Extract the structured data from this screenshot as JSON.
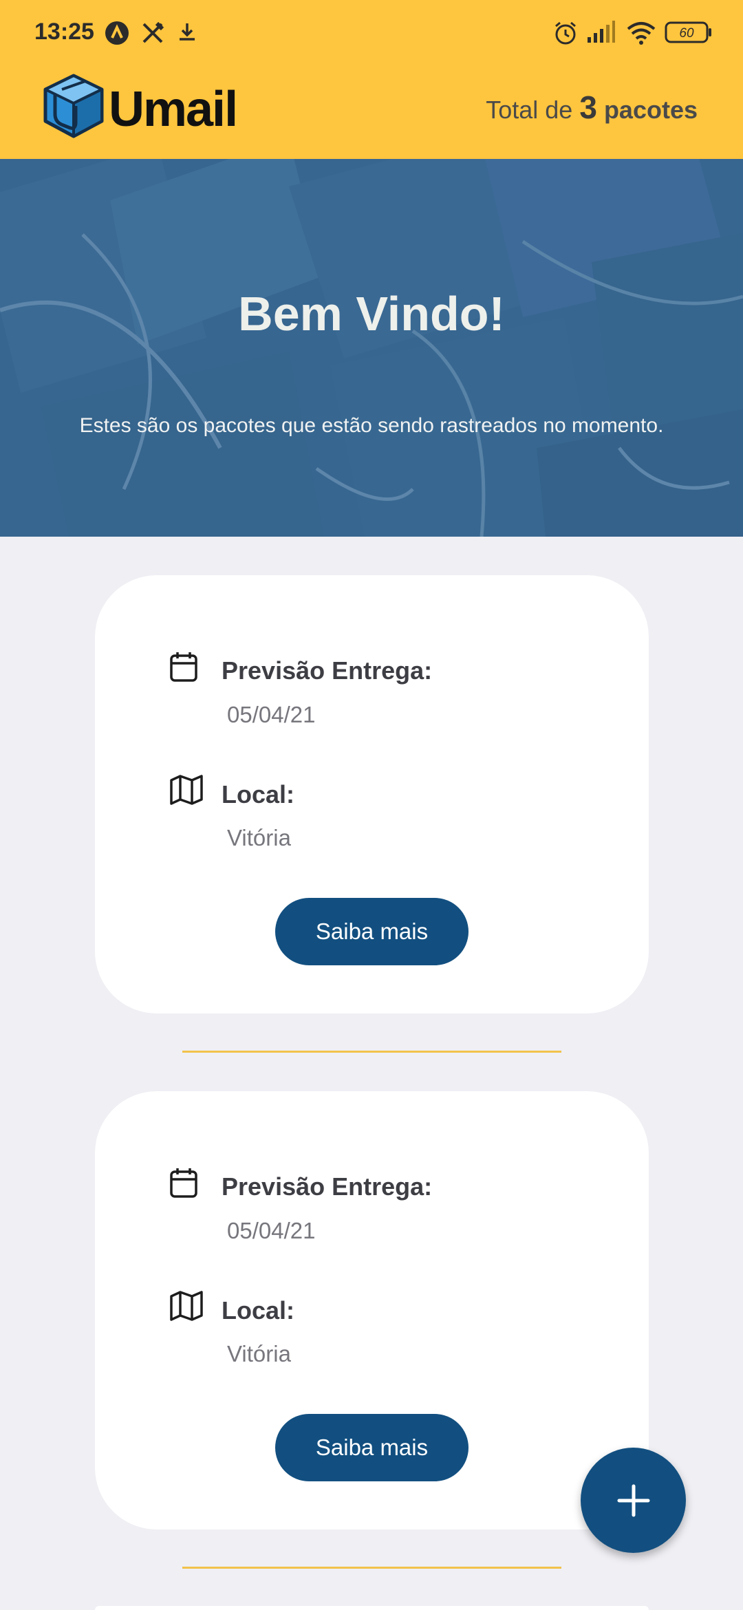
{
  "status_bar": {
    "time": "13:25",
    "battery": "60",
    "icons": [
      "app-a-icon",
      "cutlery-icon",
      "download-icon",
      "alarm-icon",
      "signal-icon",
      "wifi-icon",
      "battery-icon"
    ]
  },
  "header": {
    "brand": "Umail",
    "total_prefix": "Total de",
    "total_count": "3",
    "total_unit": "pacotes"
  },
  "hero": {
    "title": "Bem Vindo!",
    "subtitle": "Estes são os pacotes que estão sendo rastreados no momento."
  },
  "packages": [
    {
      "delivery_label": "Previsão Entrega:",
      "delivery_date": "05/04/21",
      "location_label": "Local:",
      "location": "Vitória",
      "button": "Saiba mais"
    },
    {
      "delivery_label": "Previsão Entrega:",
      "delivery_date": "05/04/21",
      "location_label": "Local:",
      "location": "Vitória",
      "button": "Saiba mais"
    }
  ],
  "colors": {
    "header_bg": "#fec53e",
    "hero_bg": "#3b6a95",
    "button": "#124f80",
    "divider": "#f2c24a",
    "page_bg": "#efeff4"
  }
}
